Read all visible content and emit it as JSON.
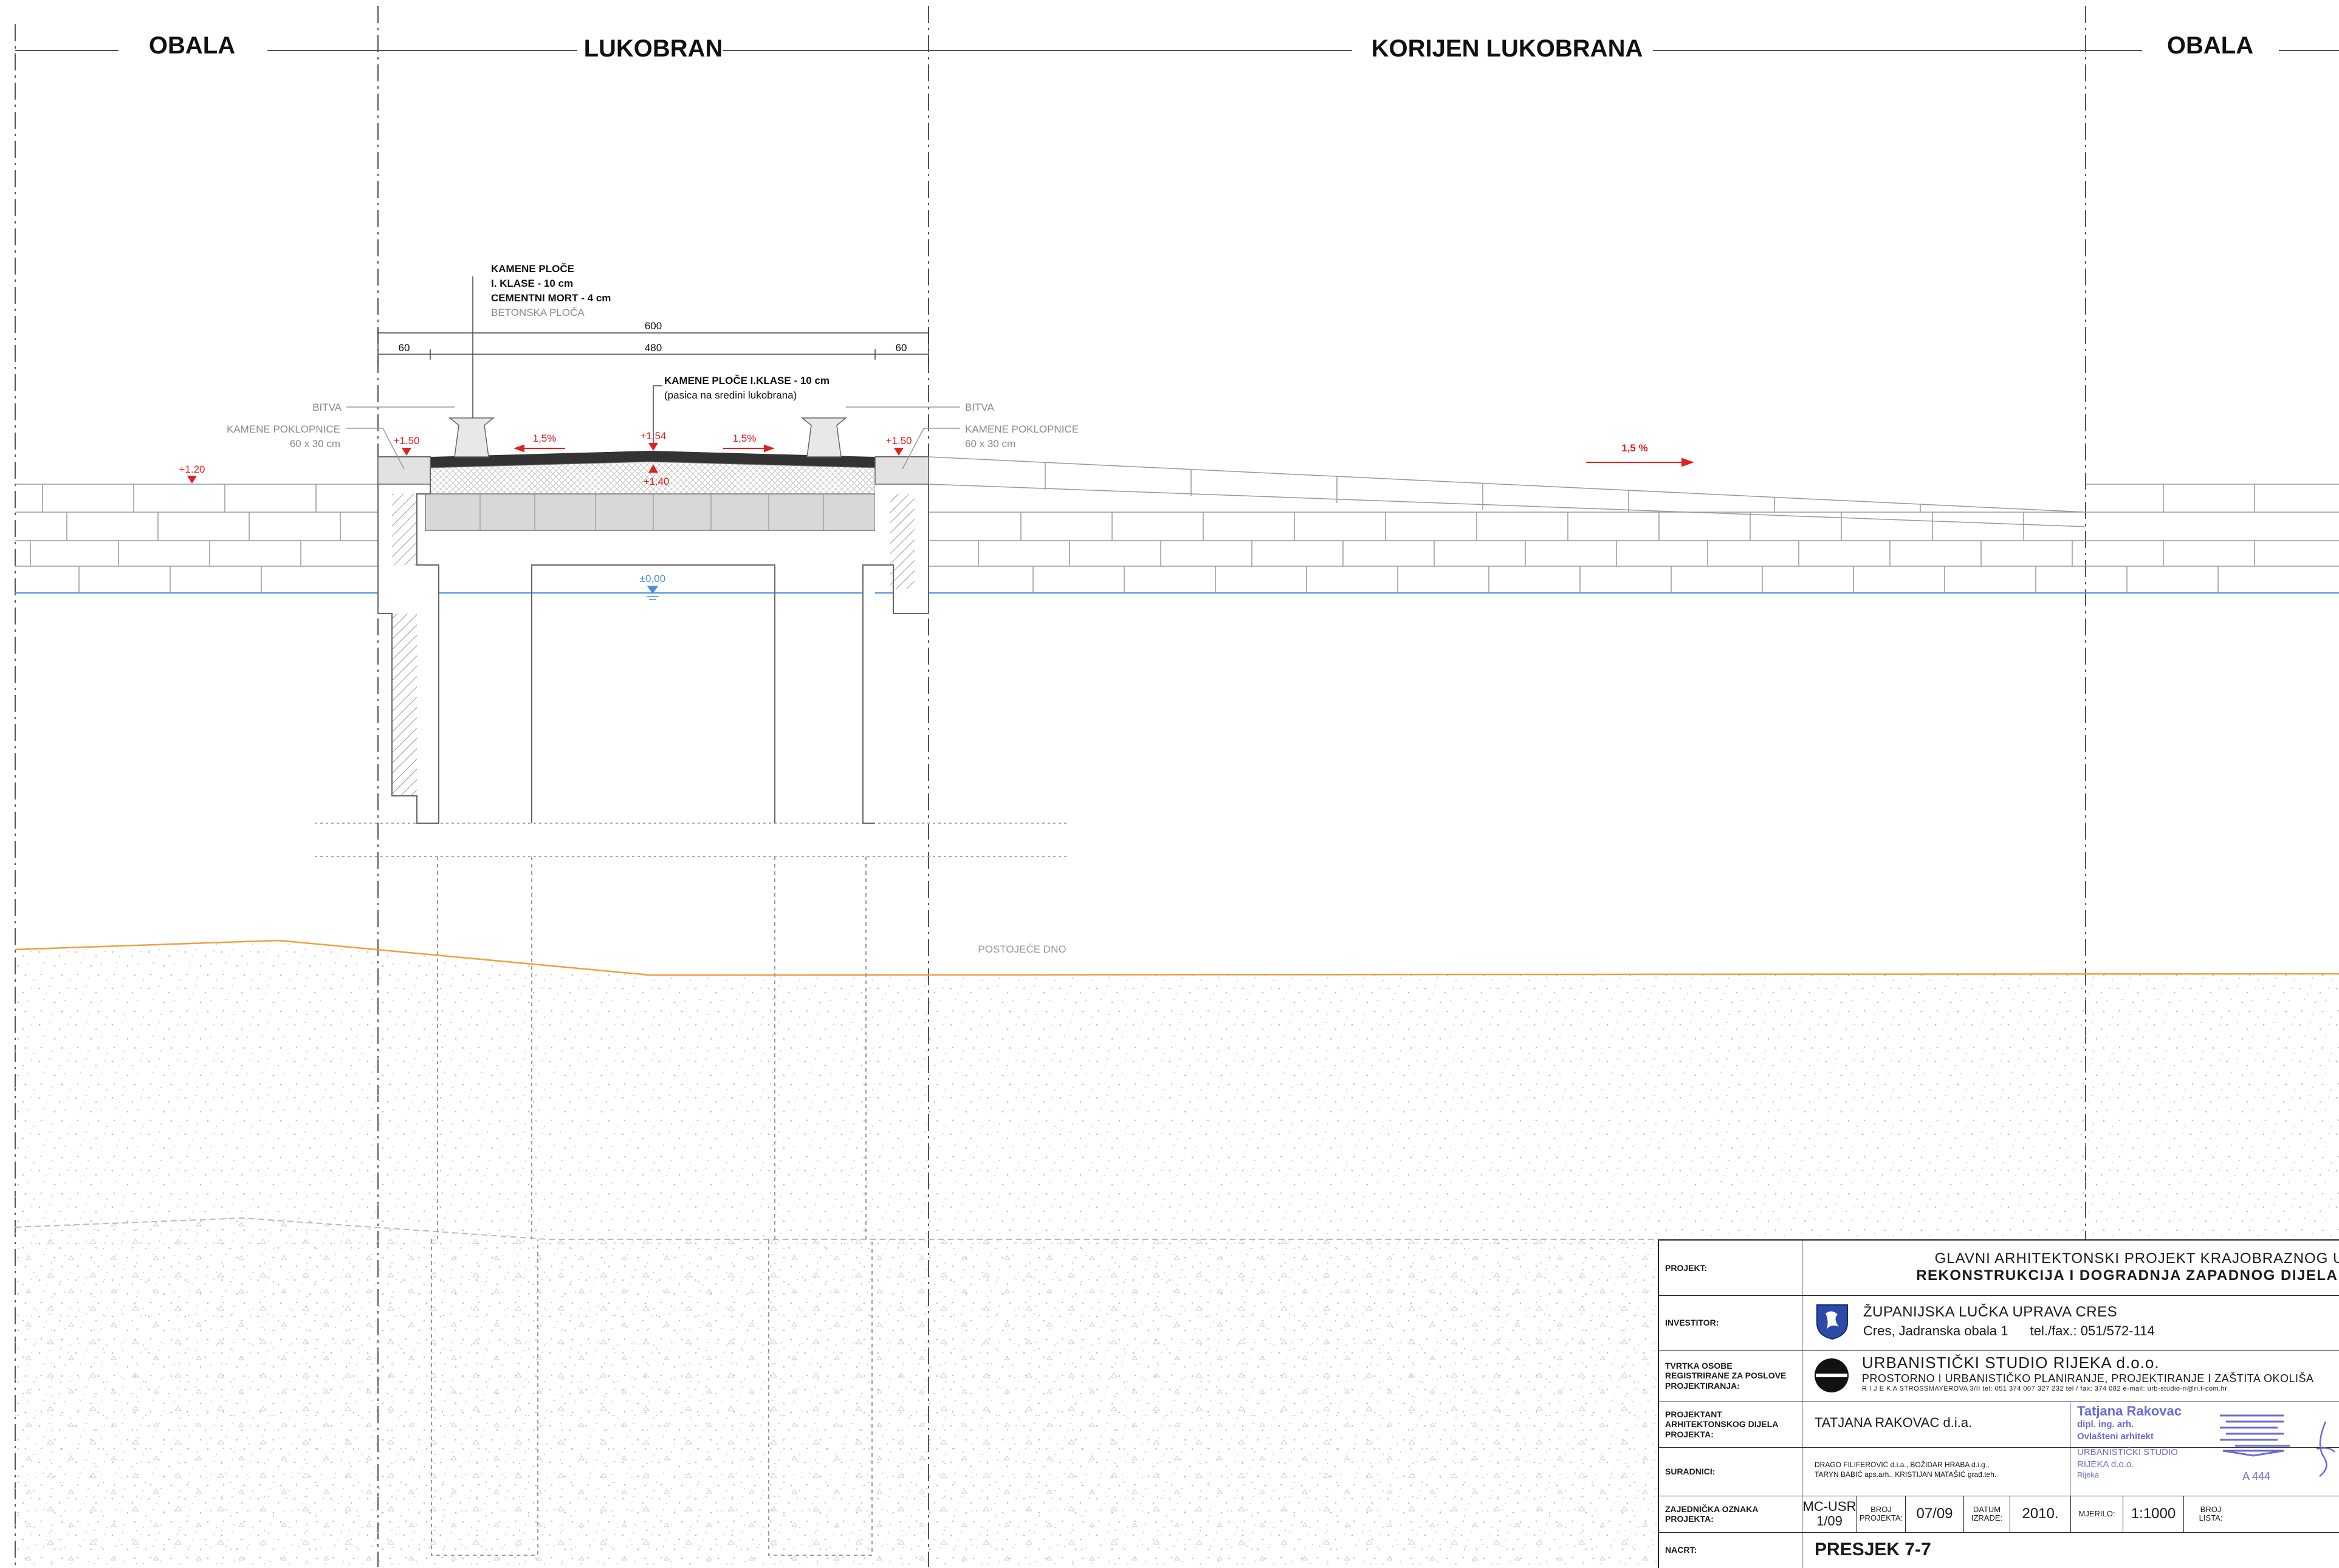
{
  "zones": {
    "obala_left": "OBALA",
    "lukobran": "LUKOBRAN",
    "korijen": "KORIJEN LUKOBRANA",
    "obala_right": "OBALA"
  },
  "annotations": {
    "layers_line1": "KAMENE PLOČE",
    "layers_line2": "I. KLASE - 10 cm",
    "layers_line3": "CEMENTNI MORT - 4 cm",
    "layers_line4": "BETONSKA PLOČA",
    "dim_total": "600",
    "dim_left": "60",
    "dim_mid": "480",
    "dim_right": "60",
    "center_note1": "KAMENE PLOČE I.KLASE - 10 cm",
    "center_note2": "(pasica na sredini lukobrana)",
    "bitva_left": "BITVA",
    "bitva_right": "BITVA",
    "poklopnice_left1": "KAMENE POKLOPNICE",
    "poklopnice_left2": "60 x 30 cm",
    "poklopnice_right1": "KAMENE POKLOPNICE",
    "poklopnice_right2": "60 x 30 cm",
    "elev_120": "+1.20",
    "elev_150_left": "+1.50",
    "elev_154": "+1.54",
    "elev_140": "+1.40",
    "elev_150_right": "+1.50",
    "slope_left": "1,5%",
    "slope_right": "1,5%",
    "slope_ramp": "1,5 %",
    "water_level": "±0,00",
    "seabed": "POSTOJEĆE DNO"
  },
  "colors": {
    "elevation": "#e02020",
    "water": "#4a8fe0",
    "seabed": "#f0a040",
    "stamp": "#6b6bd6"
  },
  "titleblock": {
    "projekt_key": "PROJEKT:",
    "projekt_line1": "GLAVNI ARHITEKTONSKI PROJEKT KRAJOBRAZNOG UREĐENJA",
    "projekt_line2": "REKONSTRUKCIJA I DOGRADNJA ZAPADNOG DIJELA LUKE CRES",
    "investitor_key": "INVESTITOR:",
    "investitor_line1": "ŽUPANIJSKA LUČKA UPRAVA CRES",
    "investitor_line2": "Cres, Jadranska obala 1",
    "investitor_tel": "tel./fax.: 051/572-114",
    "firm_key": "TVRTKA OSOBE REGISTRIRANE ZA POSLOVE PROJEKTIRANJA:",
    "firm_line1": "URBANISTIČKI STUDIO RIJEKA  d.o.o.",
    "firm_line2": "PROSTORNO I URBANISTIČKO PLANIRANJE, PROJEKTIRANJE I ZAŠTITA OKOLIŠA",
    "firm_line3": "R I J E K A   STROSSMAYEROVA 3/II       tel: 051  374 007   327 232     tel / fax: 374 082     e-mail: urb-studio-ri@ri.t-com.hr",
    "projektant_key": "PROJEKTANT ARHITEKTONSKOG DIJELA PROJEKTA:",
    "projektant_val": "TATJANA RAKOVAC d.i.a.",
    "suradnici_key": "SURADNICI:",
    "suradnici_line1": "DRAGO FILIFEROVIĆ d.i.a., BOŽIDAR HRABA d.i.g.,",
    "suradnici_line2": "TARYN BABIĆ aps.arh., KRISTIJAN MATAŠIĆ građ.teh.",
    "stamp_name": "Tatjana Rakovac",
    "stamp_title": "dipl. ing. arh.",
    "stamp_role": "Ovlašteni arhitekt",
    "stamp_firm1": "URBANISTIČKI STUDIO",
    "stamp_firm2": "RIJEKA d.o.o.",
    "stamp_city": "Rijeka",
    "stamp_num": "A 444",
    "oznaka_key": "ZAJEDNIČKA OZNAKA PROJEKTA:",
    "oznaka_val": "MC-USR 1/09",
    "broj_key": "BROJ PROJEKTA:",
    "broj_val": "07/09",
    "datum_key": "DATUM IZRADE:",
    "datum_val": "2010.",
    "mjerilo_key": "MJERILO:",
    "mjerilo_val": "1:1000",
    "list_key": "BROJ LISTA:",
    "nacrt_key": "NACRT:",
    "nacrt_val": "PRESJEK 7-7"
  }
}
